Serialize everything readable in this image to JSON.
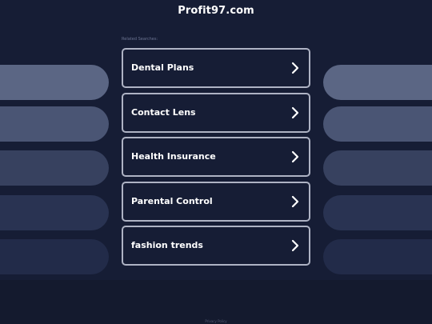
{
  "header": {
    "site_title": "Profit97.com"
  },
  "related": {
    "label": "Related Searches:",
    "items": [
      {
        "label": "Dental Plans"
      },
      {
        "label": "Contact Lens"
      },
      {
        "label": "Health Insurance"
      },
      {
        "label": "Parental Control"
      },
      {
        "label": "fashion trends"
      }
    ]
  },
  "footer": {
    "privacy_label": "Privacy Policy"
  },
  "colors": {
    "background": "#141a2e",
    "panel": "#161d35",
    "link_border": "#aeb3c4",
    "text": "#ffffff"
  },
  "icons": {
    "item_arrow": "chevron-right-icon"
  }
}
